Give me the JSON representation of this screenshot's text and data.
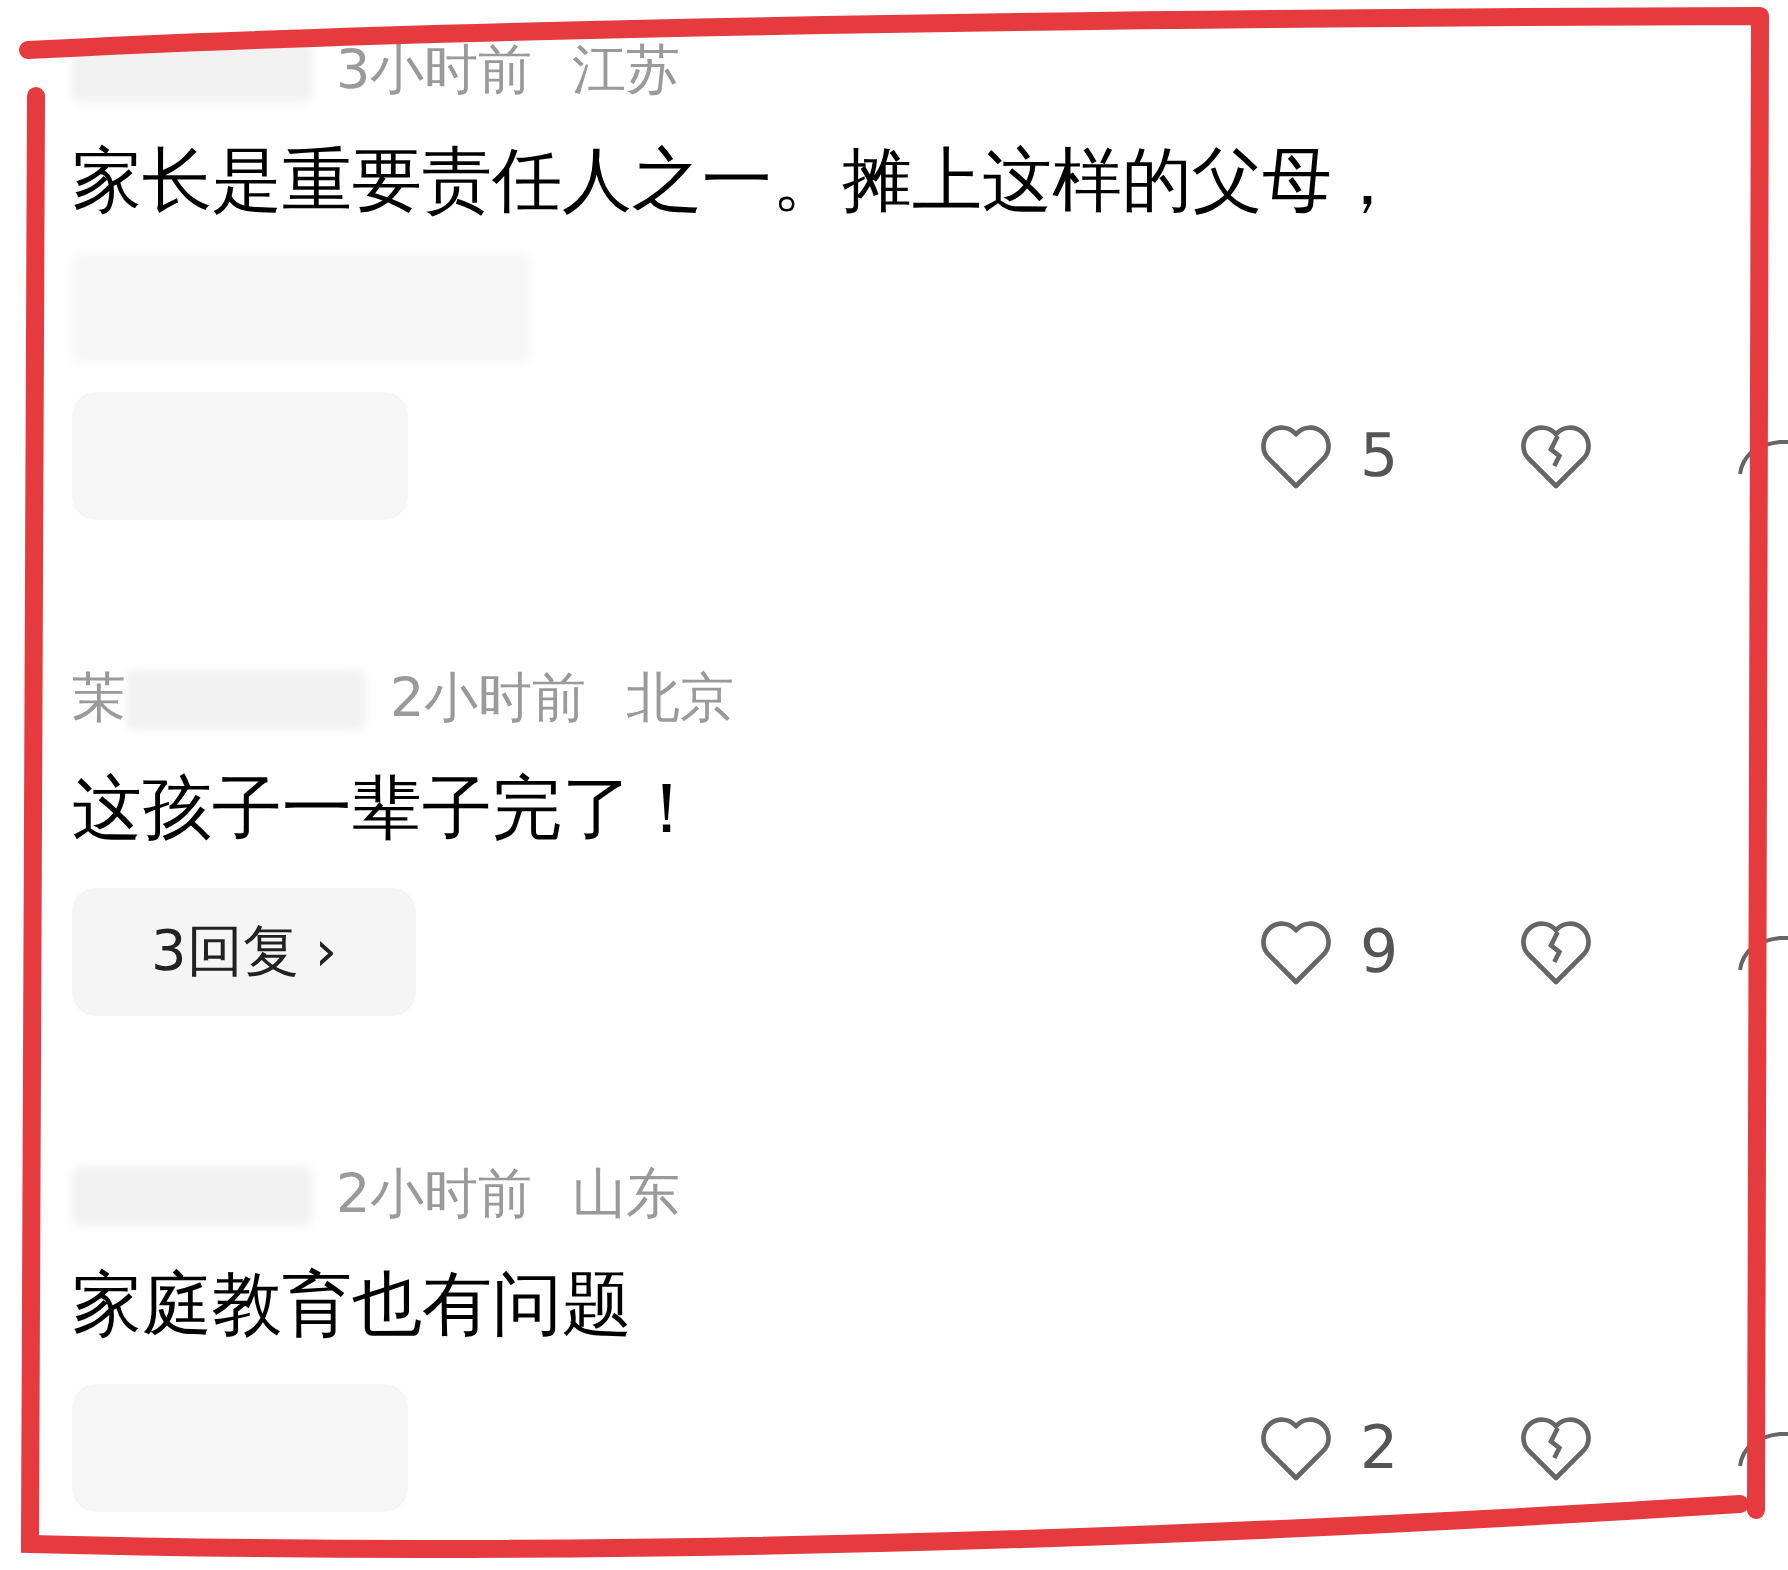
{
  "comments": [
    {
      "time": "3小时前",
      "location": "江苏",
      "text": "家长是重要责任人之一。摊上这样的父母，",
      "hidden_line": true,
      "reply_button": {
        "kind": "hidden"
      },
      "likes": "5"
    },
    {
      "username_visible": "茉",
      "time": "2小时前",
      "location": "北京",
      "text": "这孩子一辈子完了！",
      "hidden_line": false,
      "reply_button": {
        "kind": "replies",
        "label": "3回复",
        "chevron": "›"
      },
      "likes": "9"
    },
    {
      "time": "2小时前",
      "location": "山东",
      "text": "家庭教育也有问题",
      "hidden_line": false,
      "reply_button": {
        "kind": "hidden"
      },
      "likes": "2"
    }
  ]
}
